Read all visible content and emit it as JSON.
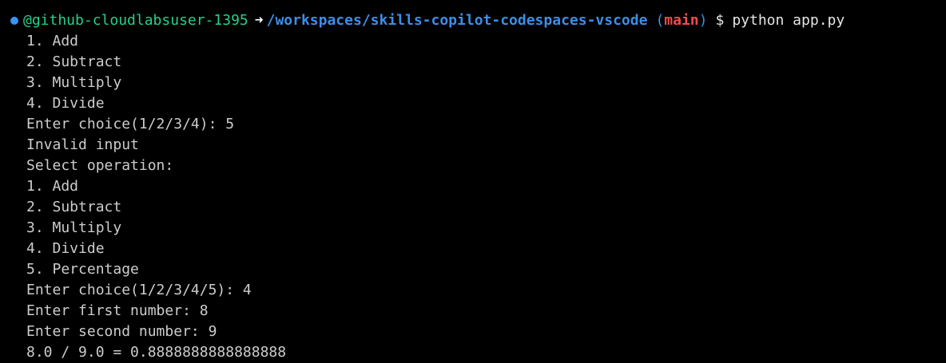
{
  "prompt": {
    "user": "@github-cloudlabsuser-1395",
    "arrow": "➜",
    "path": "/workspaces/skills-copilot-codespaces-vscode",
    "branch_open": "(",
    "branch": "main",
    "branch_close": ")",
    "dollar": "$",
    "command": "python app.py"
  },
  "output": [
    "1. Add",
    "2. Subtract",
    "3. Multiply",
    "4. Divide",
    "Enter choice(1/2/3/4): 5",
    "Invalid input",
    "Select operation:",
    "1. Add",
    "2. Subtract",
    "3. Multiply",
    "4. Divide",
    "5. Percentage",
    "Enter choice(1/2/3/4/5): 4",
    "Enter first number: 8",
    "Enter second number: 9",
    "8.0 / 9.0 = 0.8888888888888888"
  ],
  "colors": {
    "background": "#000000",
    "text": "#cccccc",
    "user": "#23d18b",
    "path": "#3b8eea",
    "branch": "#f14c4c",
    "status_dot": "#3794ff"
  }
}
